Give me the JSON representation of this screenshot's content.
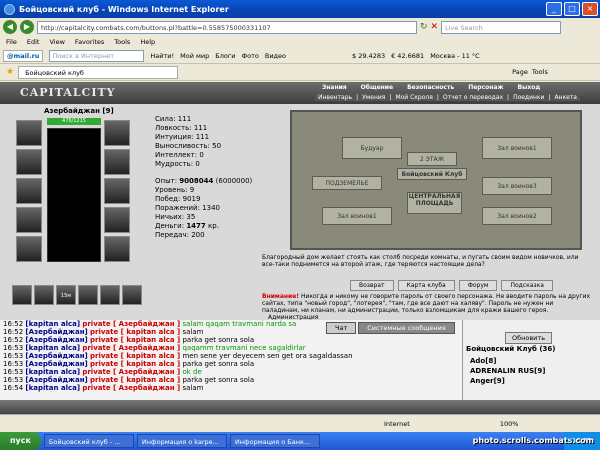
{
  "window": {
    "title": "Бойцовский клуб - Windows Internet Explorer"
  },
  "address": {
    "url": "http://capitalcity.combats.com/buttons.pl?battle=0.558575000331107",
    "live_search": "Live Search"
  },
  "menu": [
    "File",
    "Edit",
    "View",
    "Favorites",
    "Tools",
    "Help"
  ],
  "toolbar": {
    "mailru": "@mail.ru",
    "search_placeholder": "Поиск в Интернет",
    "find": "Найти!",
    "my_world": "Мой мир",
    "blogs": "Блоги",
    "photo": "Фото",
    "video": "Видео",
    "usd": "$ 29.4283",
    "eur": "€ 42.6681",
    "weather": "Москва - 11 °С"
  },
  "tab": {
    "label": "Бойцовский клуб",
    "page": "Page",
    "tools": "Tools"
  },
  "game": {
    "logo": "CAPITALCITY",
    "menu_top": [
      "Знания",
      "Общение",
      "Безопасность",
      "Персонаж",
      "Выход"
    ],
    "menu_sub": [
      "Инвентарь",
      "Умения",
      "Мой Скроля",
      "Отчет о переводах",
      "Поединки",
      "Анкета"
    ],
    "char": {
      "name": "Азербайджан [9]",
      "hp": "476/1215",
      "slot_label": "15м"
    },
    "stats": [
      {
        "label": "Сила:",
        "value": "111"
      },
      {
        "label": "Ловкость:",
        "value": "111"
      },
      {
        "label": "Интуиция:",
        "value": "111"
      },
      {
        "label": "Выносливость:",
        "value": "50"
      },
      {
        "label": "Интеллект:",
        "value": "0"
      },
      {
        "label": "Мудрость:",
        "value": "0"
      }
    ],
    "progress": [
      {
        "label": "Опыт:",
        "value": "9008044",
        "extra": "(6000000)"
      },
      {
        "label": "Уровень:",
        "value": "9"
      },
      {
        "label": "Побед:",
        "value": "9019"
      },
      {
        "label": "Поражений:",
        "value": "1340"
      },
      {
        "label": "Ничьих:",
        "value": "35"
      },
      {
        "label": "Деньги:",
        "value": "1477",
        "extra": "кр."
      },
      {
        "label": "Передач:",
        "value": "200"
      }
    ],
    "map": {
      "areas": [
        "Будуар",
        "Зал воинов1",
        "2 ЭТАЖ",
        "Бойцовский Клуб",
        "ПОДЗЕМЕЛЬЕ",
        "ЦЕНТРАЛЬНАЯ ПЛОЩАДЬ",
        "Зал воинов1",
        "Зал воинов2",
        "Зал воинов3"
      ]
    },
    "info": "Благородный дом желает стоять как столб посреди комнаты, и пугать своим видом новичков, или все-таки поднимется на второй этаж, где теряются настоящие дела?",
    "buttons": [
      "Возврат",
      "Карта клуба",
      "Форум",
      "Подсказка"
    ],
    "warning_title": "Внимание!",
    "warning": "Никогда и никому не говорите пароль от своего персонажа. Не вводите пароль на других сайтах, типа \"новый город\", \"лотерея\", \"там, где все дают на халяву\". Пароль не нужен ни паладинам, ни кланам, ни администрации, только взломщикам для кражи вашего героя.",
    "admin": "Администрация"
  },
  "chat": {
    "tabs": [
      "Чат",
      "Системные сообщения"
    ],
    "lines": [
      {
        "time": "16:52",
        "name": "[kapitan alca]",
        "priv": "private [ Азербайджан ]",
        "msg": "salam qaqam travmani narda sa",
        "green": true
      },
      {
        "time": "16:52",
        "name": "[Азербайджан]",
        "priv": "private [ kapitan alca ]",
        "msg": "salam",
        "green": false
      },
      {
        "time": "16:52",
        "name": "[Азербайджан]",
        "priv": "private [ kapitan alca ]",
        "msg": "parka get sonra sola",
        "green": false
      },
      {
        "time": "16:53",
        "name": "[kapitan alca]",
        "priv": "private [ Азербайджан ]",
        "msg": "qaqamm travmani nece sagaldirlar",
        "green": true
      },
      {
        "time": "16:53",
        "name": "[Азербайджан]",
        "priv": "private [ kapitan alca ]",
        "msg": "men sene yer deyecem sen get ora sagaldassan",
        "green": false
      },
      {
        "time": "16:53",
        "name": "[Азербайджан]",
        "priv": "private [ kapitan alca ]",
        "msg": "parka get sonra sola",
        "green": false
      },
      {
        "time": "16:53",
        "name": "[kapitan alca]",
        "priv": "private [ Азербайджан ]",
        "msg": "ok de",
        "green": true
      },
      {
        "time": "16:53",
        "name": "[Азербайджан]",
        "priv": "private [ kapitan alca ]",
        "msg": "parka get sonra sola",
        "green": false
      },
      {
        "time": "16:54",
        "name": "[kapitan alca]",
        "priv": "private [ Азербайджан ]",
        "msg": "salam",
        "green": false
      }
    ]
  },
  "online": {
    "refresh": "Обновить",
    "club": "Бойцовский Клуб (36)",
    "members": [
      "Ado[8]",
      "ADRENALIN RUS[9]",
      "Anger[9]"
    ]
  },
  "status": {
    "left": "Internet",
    "zoom": "100%"
  },
  "taskbar": {
    "start": "пуск",
    "items": [
      "Бойцовский клуб - ...",
      "Информация о karpe...",
      "Информация о Банк..."
    ],
    "clock": "16:55"
  },
  "watermark": "photo.scrolls.combats.com"
}
